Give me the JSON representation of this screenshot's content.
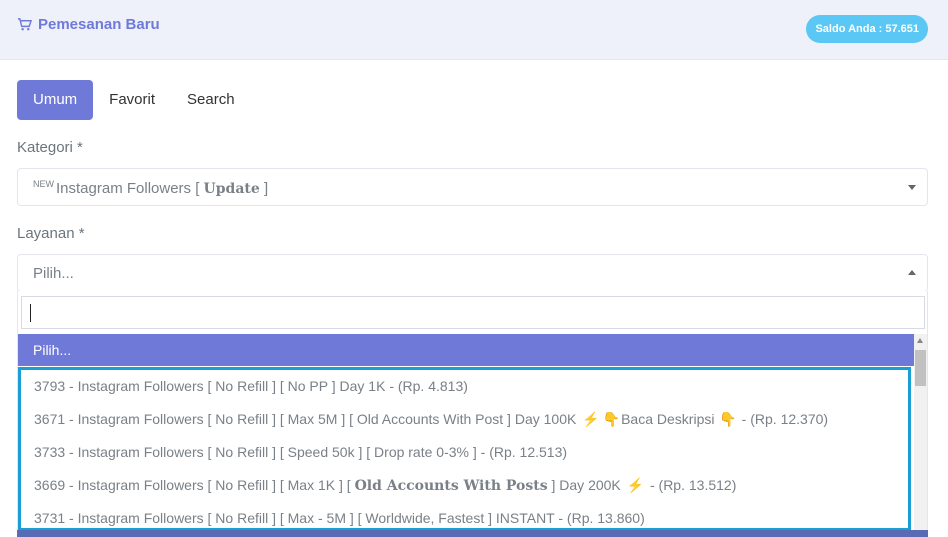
{
  "header": {
    "title": "Pemesanan Baru",
    "saldo": "Saldo Anda : 57.651"
  },
  "tabs": [
    "Umum",
    "Favorit",
    "Search"
  ],
  "kategori": {
    "label": "Kategori *",
    "badge": "NEW",
    "value_pre": "Instagram Followers [ ",
    "value_bold": "Update",
    "value_post": " ]"
  },
  "layanan": {
    "label": "Layanan *",
    "value": "Pilih..."
  },
  "dropdown": {
    "selected": "Pilih...",
    "options": [
      {
        "pre": "3793 - Instagram Followers [ No Refill ] [ No PP ] Day 1K - (Rp. 4.813)"
      },
      {
        "pre": "3671 - Instagram Followers [ No Refill ] [ Max 5M ] [ Old Accounts With Post ] Day 100K ",
        "zap": "⚡",
        "hand1": "👇",
        "mid": "Baca Deskripsi ",
        "hand2": "👇",
        "post": " - (Rp. 12.370)"
      },
      {
        "pre": "3733 - Instagram Followers [ No Refill ] [ Speed 50k ] [ Drop rate 0-3% ] - (Rp. 12.513)"
      },
      {
        "pre": "3669 - Instagram Followers [ No Refill ] [ Max 1K ] [ ",
        "bold": "Old Accounts With Posts",
        "mid": " ] Day 200K ",
        "zap": "⚡",
        "post": " - (Rp. 13.512)"
      },
      {
        "pre": "3731 - Instagram Followers [ No Refill ] [ Max - 5M ] [ Worldwide, Fastest ] INSTANT - (Rp. 13.860)"
      }
    ]
  },
  "colors": {
    "accent": "#6f7ad8",
    "saldo_badge": "#5bc7f5",
    "highlight_border": "#1a9fd4"
  }
}
